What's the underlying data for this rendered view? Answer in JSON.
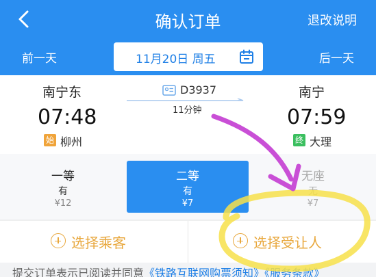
{
  "header": {
    "title": "确认订单",
    "back_icon": "chevron-left-icon",
    "policy_link": "退改说明"
  },
  "date_bar": {
    "prev_day": "前一天",
    "date": "11月20日 周五",
    "calendar_icon": "calendar-icon",
    "next_day": "后一天"
  },
  "train": {
    "number": "D3937",
    "duration": "11分钟",
    "from": {
      "station": "南宁东",
      "time": "07:48",
      "badge": "始",
      "badge_color": "#f0a43a",
      "city": "柳州"
    },
    "to": {
      "station": "南宁",
      "time": "07:59",
      "badge": "终",
      "badge_color": "#3bbf5f",
      "city": "大理"
    }
  },
  "seats": [
    {
      "name": "一等",
      "availability": "有",
      "price": "¥12",
      "state": "normal"
    },
    {
      "name": "二等",
      "availability": "有",
      "price": "¥7",
      "state": "selected"
    },
    {
      "name": "无座",
      "availability": "无",
      "price": "¥7",
      "state": "disabled"
    }
  ],
  "actions": {
    "select_passenger": "选择乘客",
    "select_beneficiary": "选择受让人"
  },
  "notice": {
    "prefix": "提交订单表示已阅读并同意",
    "link1": "《铁路互联网购票须知》",
    "link2": "《服务条款》"
  },
  "colors": {
    "primary": "#2a8ef0",
    "accent": "#e8a73c",
    "annotation_arrow": "#c94fd6",
    "annotation_highlight": "#f7e04a"
  }
}
